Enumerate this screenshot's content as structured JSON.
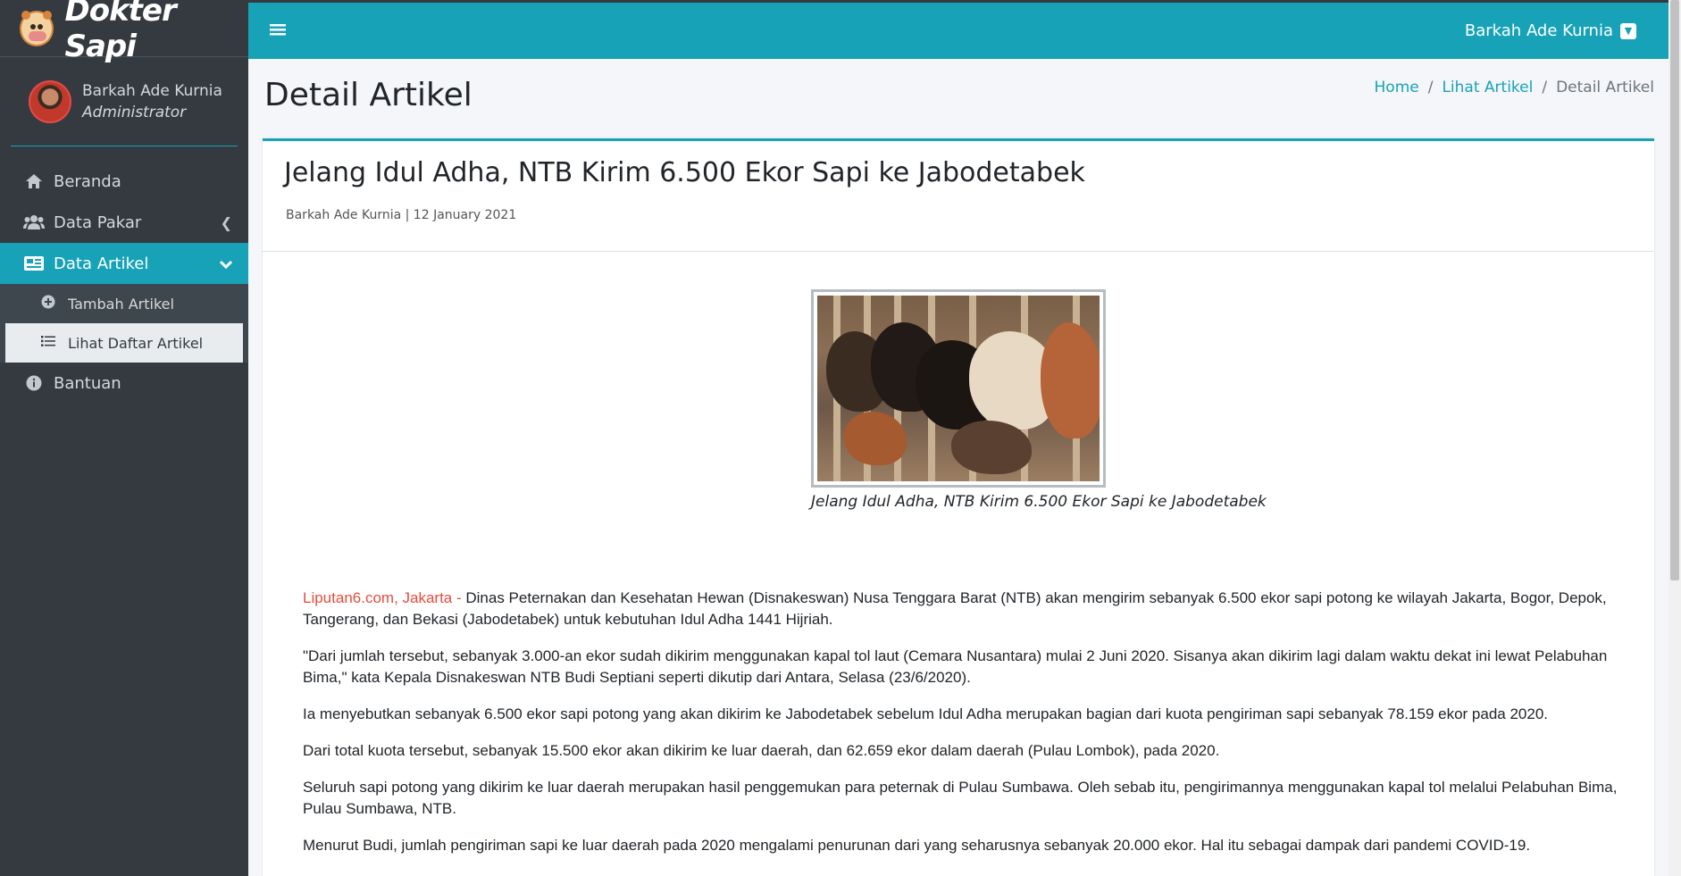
{
  "brand": {
    "name": "Dokter Sapi"
  },
  "user": {
    "name": "Barkah Ade Kurnia",
    "role": "Administrator"
  },
  "sidebar": {
    "items": [
      {
        "label": "Beranda",
        "icon": "home-icon"
      },
      {
        "label": "Data Pakar",
        "icon": "users-icon"
      },
      {
        "label": "Data Artikel",
        "icon": "newspaper-icon"
      },
      {
        "label": "Bantuan",
        "icon": "info-icon"
      }
    ],
    "subitems": [
      {
        "label": "Tambah Artikel",
        "icon": "plus-circle-icon"
      },
      {
        "label": "Lihat Daftar Artikel",
        "icon": "list-icon"
      }
    ]
  },
  "topbar": {
    "user_label": "Barkah Ade Kurnia"
  },
  "page": {
    "title": "Detail Artikel"
  },
  "breadcrumb": [
    "Home",
    "Lihat Artikel",
    "Detail Artikel"
  ],
  "article": {
    "title": "Jelang Idul Adha, NTB Kirim 6.500 Ekor Sapi ke Jabodetabek",
    "meta": "Barkah Ade Kurnia | 12 January 2021",
    "image_caption": "Jelang Idul Adha, NTB Kirim 6.500 Ekor Sapi ke Jabodetabek",
    "source": "Liputan6.com, Jakarta - ",
    "paragraphs": [
      "Dinas Peternakan dan Kesehatan Hewan (Disnakeswan) Nusa Tenggara Barat (NTB) akan mengirim sebanyak 6.500 ekor sapi potong ke wilayah Jakarta, Bogor, Depok, Tangerang, dan Bekasi (Jabodetabek) untuk kebutuhan Idul Adha 1441 Hijriah.",
      "\"Dari jumlah tersebut, sebanyak 3.000-an ekor sudah dikirim menggunakan kapal tol laut (Cemara Nusantara) mulai 2 Juni 2020. Sisanya akan dikirim lagi dalam waktu dekat ini lewat Pelabuhan Bima,\" kata Kepala Disnakeswan NTB Budi Septiani seperti dikutip dari Antara, Selasa (23/6/2020).",
      "Ia menyebutkan sebanyak 6.500 ekor sapi potong yang akan dikirim ke Jabodetabek sebelum Idul Adha merupakan bagian dari kuota pengiriman sapi sebanyak 78.159 ekor pada 2020.",
      "Dari total kuota tersebut, sebanyak 15.500 ekor akan dikirim ke luar daerah, dan 62.659 ekor dalam daerah (Pulau Lombok), pada 2020.",
      "Seluruh sapi potong yang dikirim ke luar daerah merupakan hasil penggemukan para peternak di Pulau Sumbawa. Oleh sebab itu, pengirimannya menggunakan kapal tol melalui Pelabuhan Bima, Pulau Sumbawa, NTB.",
      "Menurut Budi, jumlah pengiriman sapi ke luar daerah pada 2020 mengalami penurunan dari yang seharusnya sebanyak 20.000 ekor. Hal itu sebagai dampak dari pandemi COVID-19."
    ]
  },
  "colors": {
    "accent": "#17a2b8",
    "sidebar": "#343a40",
    "source": "#e74c3c"
  }
}
